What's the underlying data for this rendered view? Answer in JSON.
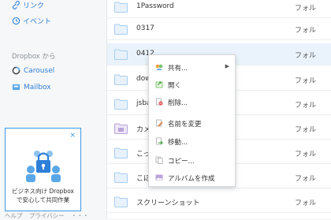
{
  "sidebar": {
    "links": [
      {
        "label": "リンク",
        "icon": "link-icon"
      },
      {
        "label": "イベント",
        "icon": "events-icon"
      }
    ],
    "section_title": "Dropbox から",
    "apps": [
      {
        "label": "Carousel",
        "icon": "carousel-icon"
      },
      {
        "label": "Mailbox",
        "icon": "mailbox-icon"
      }
    ],
    "promo": {
      "close": "×",
      "line1": "ビジネス向け Dropbox",
      "line2": "で安心して共同作業"
    },
    "footer": [
      "ヘルプ",
      "プライバシー",
      "・・・"
    ]
  },
  "files": [
    {
      "name": "1Password",
      "kind": "フォル"
    },
    {
      "name": "0317",
      "kind": "フォル"
    },
    {
      "name": "0412",
      "kind": "フォル"
    },
    {
      "name": "dow",
      "kind": "フォル"
    },
    {
      "name": "jsba",
      "kind": "フォル"
    },
    {
      "name": "カメラ",
      "kind": "フォル"
    },
    {
      "name": "こっか",
      "kind": "フォル"
    },
    {
      "name": "こほ",
      "kind": "フォル"
    },
    {
      "name": "スクリーンショット",
      "kind": "フォル"
    }
  ],
  "context_menu": {
    "items": [
      {
        "label": "共有...",
        "icon": "share-icon",
        "submenu": "▶"
      },
      {
        "label": "開く",
        "icon": "open-icon"
      },
      {
        "label": "削除...",
        "icon": "delete-icon"
      },
      {
        "label": "名前を変更",
        "icon": "rename-icon"
      },
      {
        "label": "移動...",
        "icon": "move-icon"
      },
      {
        "label": "コピー...",
        "icon": "copy-icon"
      },
      {
        "label": "アルバムを作成",
        "icon": "album-icon"
      }
    ]
  },
  "colors": {
    "accent": "#2e7fd8",
    "selected_row": "#eaf3fc",
    "folder": "#a9d0f5"
  }
}
